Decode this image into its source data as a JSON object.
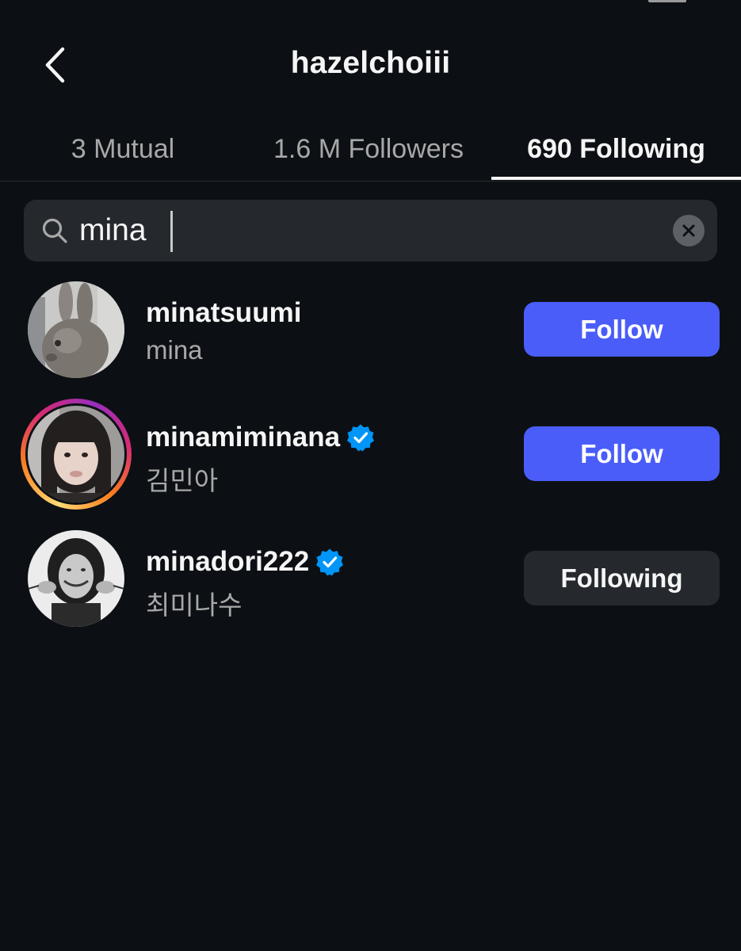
{
  "header": {
    "title": "hazelchoiii"
  },
  "tabs": [
    {
      "label": "3 Mutual",
      "active": false
    },
    {
      "label": "1.6 M Followers",
      "active": false
    },
    {
      "label": "690 Following",
      "active": true
    }
  ],
  "search": {
    "value": "mina",
    "placeholder": "Search"
  },
  "results": [
    {
      "username": "minatsuumi",
      "fullname": "mina",
      "verified": false,
      "has_story_ring": false,
      "button_label": "Follow",
      "button_state": "follow"
    },
    {
      "username": "minamiminana",
      "fullname": "김민아",
      "verified": true,
      "has_story_ring": true,
      "button_label": "Follow",
      "button_state": "follow"
    },
    {
      "username": "minadori222",
      "fullname": "최미나수",
      "verified": true,
      "has_story_ring": false,
      "button_label": "Following",
      "button_state": "following"
    }
  ],
  "colors": {
    "background": "#0c1014",
    "follow_button": "#4a5df9",
    "following_button": "#25292e",
    "verified_badge": "#0095f6",
    "secondary_text": "#a8a8a8"
  },
  "icons": {
    "back": "chevron-left-icon",
    "search": "search-icon",
    "clear": "close-circle-icon",
    "verified": "verified-badge-icon"
  }
}
